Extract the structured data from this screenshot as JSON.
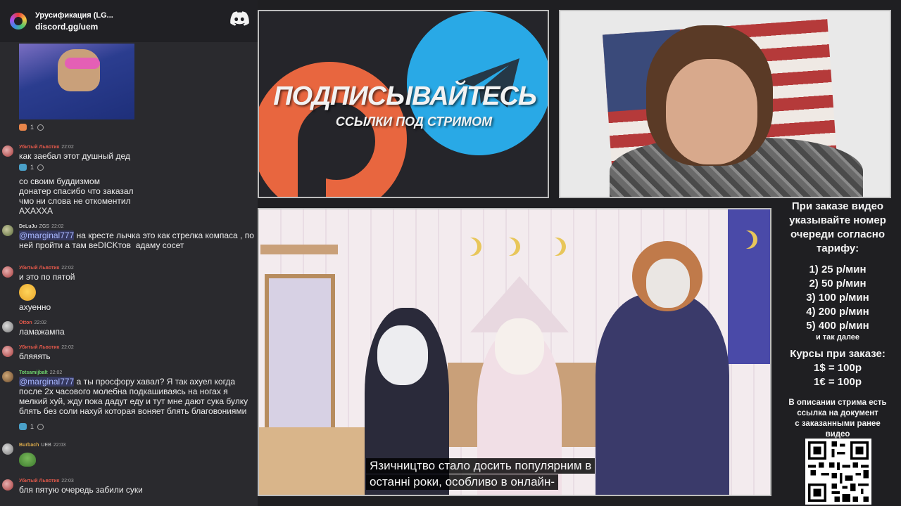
{
  "chat": {
    "server_name": "Урусификация (LG...",
    "invite": "discord.gg/uem",
    "thumb_reaction_count": "1",
    "messages": [
      {
        "user": "Убитый Львотик",
        "time": "22:02",
        "lines": [
          "как заебал этот душный дед"
        ],
        "reaction": "1"
      },
      {
        "lines": [
          "со своим буддизмом",
          "донатер спасибо что заказал",
          "чмо ни слова не откоментил",
          "АХАХХА"
        ]
      },
      {
        "user": "DeLuJu",
        "tag": "ZGS",
        "time": "22:02",
        "mention": "@marginal777",
        "text": " на кресте лычка это как стрелка компаса , по ней пройти а там веDICKтов  адаму сосет"
      },
      {
        "user": "Убитый Львотик",
        "time": "22:02",
        "lines": [
          "и это по пятой"
        ],
        "emoji": "laughing-emoji",
        "after": "ахуенно"
      },
      {
        "user": "Otton",
        "time": "22:02",
        "lines": [
          "ламажампа"
        ]
      },
      {
        "user": "Убитый Львотик",
        "time": "22:02",
        "lines": [
          "бляяять"
        ]
      },
      {
        "user": "Totsamijbalt",
        "time": "22:02",
        "mention": "@marginal777",
        "text": " а ты просфору хавал? Я так ахуел когда после 2х часового молебна подкашиваясь на ногах я мелкий хуй, жду пока дадут еду и тут мне дают сука булку блять без соли нахуй которая воняет блять благовониями",
        "reaction": "1"
      },
      {
        "user": "Burbach",
        "tag": "UEB",
        "time": "22:03",
        "emoji": "pepe-emoji"
      },
      {
        "user": "Убитый Львотик",
        "time": "22:03",
        "lines": [
          "бля пятую очередь забили суки"
        ]
      }
    ]
  },
  "promo": {
    "title": "ПОДПИСЫВАЙТЕСЬ",
    "subtitle": "ССЫЛКИ ПОД СТРИМОМ"
  },
  "video": {
    "subtitle_line1": "Язичництво стало досить популярним в",
    "subtitle_line2": "останні роки, особливо в онлайн-"
  },
  "info": {
    "header": [
      "При заказе видео",
      "указывайте номер",
      "очереди согласно",
      "тарифу:"
    ],
    "rates": [
      "1) 25 р/мин",
      "2) 50 р/мин",
      "3) 100 р/мин",
      "4) 200 р/мин",
      "5) 400 р/мин"
    ],
    "etc": "и так далее",
    "currency_header": "Курсы при заказе:",
    "currency": [
      "1$ = 100р",
      "1€ = 100р"
    ],
    "desc": [
      "В описании стрима есть",
      "ссылка на документ",
      "с заказанными ранее",
      "видео"
    ]
  },
  "colors": {
    "chat_bg": "#2a2a2e",
    "header_bg": "#202024",
    "mention": "#a9b8ff",
    "username_red": "#e0584a",
    "patreon": "#e8663f",
    "telegram": "#29a9e6"
  }
}
